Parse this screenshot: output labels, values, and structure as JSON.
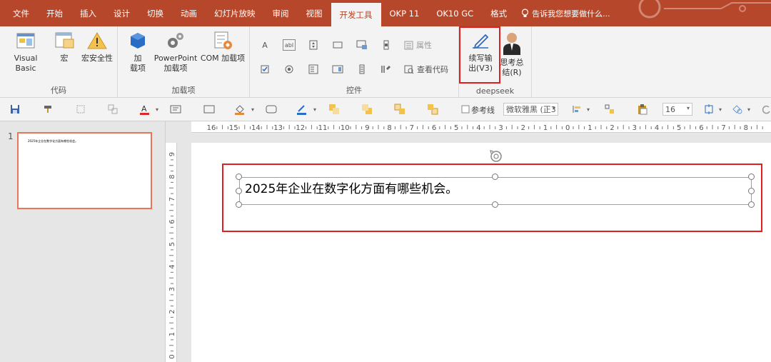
{
  "tabs": [
    {
      "label": "文件",
      "active": false
    },
    {
      "label": "开始",
      "active": false
    },
    {
      "label": "插入",
      "active": false
    },
    {
      "label": "设计",
      "active": false
    },
    {
      "label": "切换",
      "active": false
    },
    {
      "label": "动画",
      "active": false
    },
    {
      "label": "幻灯片放映",
      "active": false
    },
    {
      "label": "审阅",
      "active": false
    },
    {
      "label": "视图",
      "active": false
    },
    {
      "label": "开发工具",
      "active": true
    },
    {
      "label": "OKP 11",
      "active": false
    },
    {
      "label": "OK10 GC",
      "active": false
    },
    {
      "label": "格式",
      "active": false
    }
  ],
  "tell_me": "告诉我您想要做什么...",
  "ribbon": {
    "code_group": {
      "label": "代码",
      "visual_basic": "Visual Basic",
      "macro": "宏",
      "macro_security": "宏安全性"
    },
    "addins_group": {
      "label": "加载项",
      "addins_line1": "加",
      "addins_line2": "载项",
      "ppt_addins_line1": "PowerPoint",
      "ppt_addins_line2": "加载项",
      "com_addins": "COM 加载项"
    },
    "controls_group": {
      "label": "控件",
      "properties": "属性",
      "view_code": "查看代码"
    },
    "deepseek_group": {
      "label": "deepseek",
      "continue_line1": "续写输",
      "continue_line2": "出(V3)",
      "think_line1": "思考总",
      "think_line2": "结(R)"
    }
  },
  "format_bar": {
    "gridlines_label": "参考线",
    "font_name": "微软雅黑 (正3",
    "font_size": "16"
  },
  "thumbnails": [
    {
      "number": "1",
      "text": "2025年企业在数字化方面有哪些机会。"
    }
  ],
  "slide": {
    "text": "2025年企业在数字化方面有哪些机会。"
  },
  "hruler_labels": [
    "16",
    "15",
    "14",
    "13",
    "12",
    "11",
    "10",
    "9",
    "8",
    "7",
    "6",
    "5",
    "4",
    "3",
    "2",
    "1",
    "0",
    "1",
    "2",
    "3",
    "4",
    "5",
    "6",
    "7",
    "8"
  ],
  "vruler_labels": [
    "9",
    "8",
    "7",
    "6",
    "5",
    "4",
    "3",
    "2",
    "1",
    "0"
  ],
  "colors": {
    "tab_bar": "#b7472a",
    "ribbon": "#f3f3f3",
    "highlight": "#e02020",
    "selected_thumb_border": "#e8765a"
  }
}
